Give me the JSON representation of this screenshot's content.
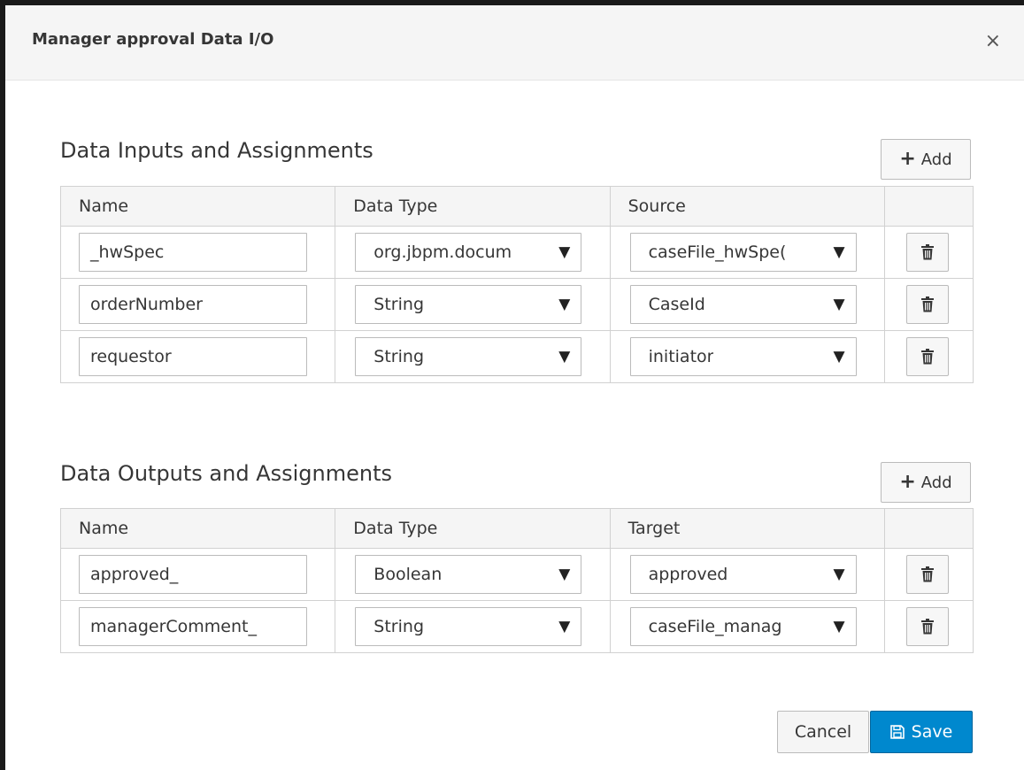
{
  "dialog": {
    "title": "Manager approval Data I/O",
    "close_glyph": "×"
  },
  "inputs": {
    "section_title": "Data Inputs and Assignments",
    "add_label": "Add",
    "headers": [
      "Name",
      "Data Type",
      "Source"
    ],
    "rows": [
      {
        "name": "_hwSpec",
        "type": "org.jbpm.docum",
        "source": "caseFile_hwSpe("
      },
      {
        "name": "orderNumber",
        "type": "String",
        "source": "CaseId"
      },
      {
        "name": "requestor",
        "type": "String",
        "source": "initiator"
      }
    ]
  },
  "outputs": {
    "section_title": "Data Outputs and Assignments",
    "add_label": "Add",
    "headers": [
      "Name",
      "Data Type",
      "Target"
    ],
    "rows": [
      {
        "name": "approved_",
        "type": "Boolean",
        "target": "approved"
      },
      {
        "name": "managerComment_",
        "type": "String",
        "target": "caseFile_manag"
      }
    ]
  },
  "footer": {
    "cancel_label": "Cancel",
    "save_label": "Save"
  },
  "icons": {
    "add": "plus-icon",
    "delete": "trash-icon",
    "save": "floppy-disk-icon",
    "dropdown": "caret-down-icon",
    "close": "close-icon"
  },
  "colors": {
    "primary": "#0088ce",
    "header_bg": "#f5f5f5"
  }
}
